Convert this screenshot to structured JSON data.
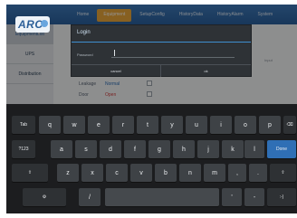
{
  "app": {
    "logo_text": "ARC"
  },
  "nav": {
    "tabs": [
      {
        "label": "Home",
        "active": false
      },
      {
        "label": "Equipment",
        "active": true
      },
      {
        "label": "SetupConfig",
        "active": false
      },
      {
        "label": "HistoryData",
        "active": false
      },
      {
        "label": "HistoryAlarm",
        "active": false
      },
      {
        "label": "System",
        "active": false
      }
    ]
  },
  "sidebar": {
    "items": [
      {
        "label": "EquipmentList",
        "selected": true
      },
      {
        "label": "UPS",
        "selected": false
      },
      {
        "label": "Distribution",
        "selected": false
      }
    ]
  },
  "content": {
    "rows": [
      {
        "label": "Leakage",
        "value": "Normal",
        "value_color": "#2f6fb5"
      },
      {
        "label": "Door",
        "value": "Open",
        "value_color": "#d04040"
      }
    ],
    "hint": "Input"
  },
  "dialog": {
    "title": "Login",
    "password_label": "Password",
    "password_value": "",
    "cancel_label": "cancel",
    "ok_label": "ok"
  },
  "keyboard": {
    "row1": [
      "Tab",
      "q",
      "w",
      "e",
      "r",
      "t",
      "y",
      "u",
      "i",
      "o",
      "p",
      "⌫"
    ],
    "row2": [
      "?123",
      "a",
      "s",
      "d",
      "f",
      "g",
      "h",
      "j",
      "k",
      "l",
      "Done"
    ],
    "row3": [
      "⇧",
      "z",
      "x",
      "c",
      "v",
      "b",
      "n",
      "m",
      ",",
      ".",
      "⇧"
    ],
    "row4": [
      "⚙",
      "/",
      "",
      "'",
      "-",
      ":-)"
    ]
  },
  "colors": {
    "accent": "#2f6fb5",
    "tab_active": "#e9a53a"
  }
}
